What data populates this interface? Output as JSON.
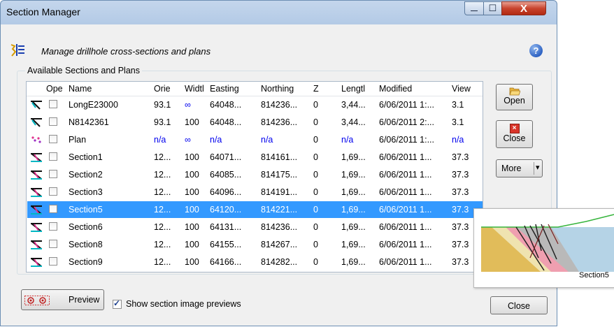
{
  "window": {
    "title": "Section Manager",
    "minimize_glyph": "—",
    "maximize_glyph": "☐",
    "close_glyph": "X"
  },
  "header": {
    "description": "Manage drillhole cross-sections and plans",
    "help_glyph": "?"
  },
  "group_label": "Available Sections and Plans",
  "columns": [
    "Ope",
    "Name",
    "Orie",
    "Widtl",
    "Easting",
    "Northing",
    "Z",
    "Lengtl",
    "Modified",
    "View"
  ],
  "rows": [
    {
      "icon": "long-section-icon",
      "name": "LongE23000",
      "orient": "93.1",
      "width": "∞",
      "easting": "64048...",
      "northing": "814236...",
      "z": "0",
      "length": "3,44...",
      "modified": "6/06/2011 1:...",
      "view": "3.1"
    },
    {
      "icon": "long-section-icon",
      "name": "N8142361",
      "orient": "93.1",
      "width": "100",
      "easting": "64048...",
      "northing": "814236...",
      "z": "0",
      "length": "3,44...",
      "modified": "6/06/2011 2:...",
      "view": "3.1"
    },
    {
      "icon": "plan-icon",
      "name": "Plan",
      "orient": "n/a",
      "width": "∞",
      "easting": "n/a",
      "northing": "n/a",
      "z": "0",
      "length": "n/a",
      "modified": "6/06/2011 1:...",
      "view": "n/a"
    },
    {
      "icon": "cross-section-icon",
      "name": "Section1",
      "orient": "12...",
      "width": "100",
      "easting": "64071...",
      "northing": "814161...",
      "z": "0",
      "length": "1,69...",
      "modified": "6/06/2011 1...",
      "view": "37.3"
    },
    {
      "icon": "cross-section-icon",
      "name": "Section2",
      "orient": "12...",
      "width": "100",
      "easting": "64085...",
      "northing": "814175...",
      "z": "0",
      "length": "1,69...",
      "modified": "6/06/2011 1...",
      "view": "37.3"
    },
    {
      "icon": "cross-section-icon",
      "name": "Section3",
      "orient": "12...",
      "width": "100",
      "easting": "64096...",
      "northing": "814191...",
      "z": "0",
      "length": "1,69...",
      "modified": "6/06/2011 1...",
      "view": "37.3"
    },
    {
      "icon": "cross-section-icon",
      "name": "Section5",
      "orient": "12...",
      "width": "100",
      "easting": "64120...",
      "northing": "814221...",
      "z": "0",
      "length": "1,69...",
      "modified": "6/06/2011 1...",
      "view": "37.3",
      "selected": true
    },
    {
      "icon": "cross-section-icon",
      "name": "Section6",
      "orient": "12...",
      "width": "100",
      "easting": "64131...",
      "northing": "814236...",
      "z": "0",
      "length": "1,69...",
      "modified": "6/06/2011 1...",
      "view": "37.3"
    },
    {
      "icon": "cross-section-icon",
      "name": "Section8",
      "orient": "12...",
      "width": "100",
      "easting": "64155...",
      "northing": "814267...",
      "z": "0",
      "length": "1,69...",
      "modified": "6/06/2011 1...",
      "view": "37.3"
    },
    {
      "icon": "cross-section-icon",
      "name": "Section9",
      "orient": "12...",
      "width": "100",
      "easting": "64166...",
      "northing": "814282...",
      "z": "0",
      "length": "1,69...",
      "modified": "6/06/2011 1...",
      "view": "37.3"
    }
  ],
  "side_buttons": {
    "open": "Open",
    "close": "Close",
    "more": "More",
    "more_arrow": "▾"
  },
  "preview_popup_label": "Section5",
  "bottom": {
    "preview": "Preview",
    "show_previews": "Show section image previews",
    "show_previews_checked": true,
    "close": "Close"
  },
  "colors": {
    "selection": "#3399ff",
    "link_blue": "#0000ee"
  }
}
